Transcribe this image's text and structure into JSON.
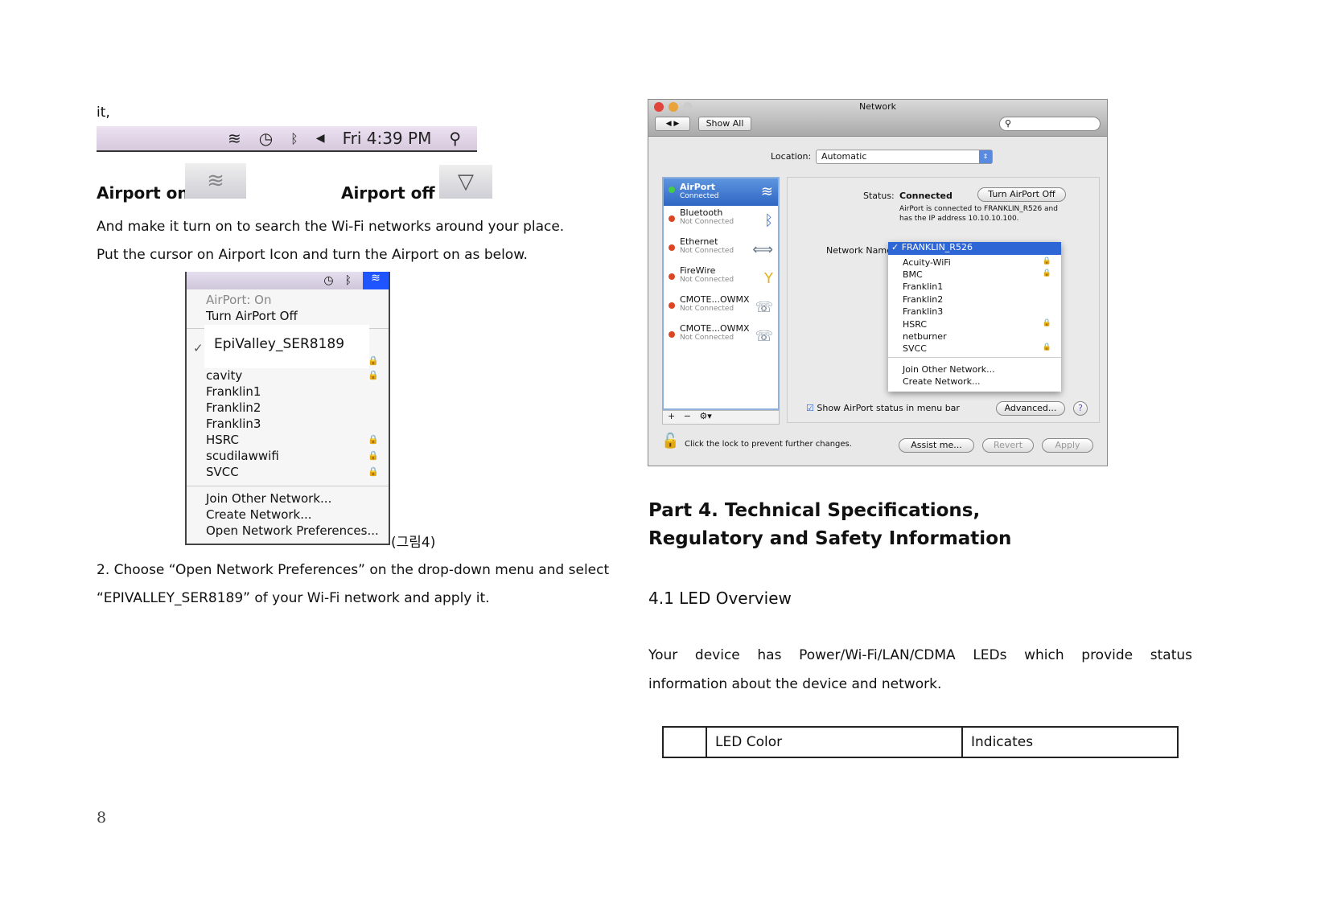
{
  "intro": "it,",
  "menubar": {
    "time": "Fri 4:39 PM",
    "icons": [
      "wifi-icon",
      "time-machine-icon",
      "bluetooth-icon",
      "volume-icon",
      "spotlight-icon"
    ]
  },
  "airport_on_label": "Airport on",
  "airport_off_label": "Airport off",
  "para1": "And make it turn on to search the Wi-Fi networks around your place.",
  "para2": "Put the cursor on Airport Icon and turn the Airport on as below.",
  "menu": {
    "status": "AirPort: On",
    "turn_off": "Turn AirPort Off",
    "selected": "EpiValley_SER8189",
    "networks": [
      {
        "name": "cavity",
        "locked": true
      },
      {
        "name": "Franklin1",
        "locked": false
      },
      {
        "name": "Franklin2",
        "locked": false
      },
      {
        "name": "Franklin3",
        "locked": false
      },
      {
        "name": "HSRC",
        "locked": true
      },
      {
        "name": "scudilawwifi",
        "locked": true
      },
      {
        "name": "SVCC",
        "locked": true
      }
    ],
    "join": "Join Other Network...",
    "create": "Create Network...",
    "open_prefs": "Open Network Preferences..."
  },
  "figure_caption": "(그림4)",
  "step2_line1": "2. Choose “Open Network Preferences” on the drop-down menu and select",
  "step2_line2": "“EPIVALLEY_SER8189” of your Wi-Fi network and apply it.",
  "window": {
    "title": "Network",
    "show_all": "Show All",
    "location_label": "Location:",
    "location_value": "Automatic",
    "services": [
      {
        "name": "AirPort",
        "status": "Connected",
        "icon": "wifi-icon",
        "connected": true
      },
      {
        "name": "Bluetooth",
        "status": "Not Connected",
        "icon": "bluetooth-icon",
        "connected": false
      },
      {
        "name": "Ethernet",
        "status": "Not Connected",
        "icon": "ethernet-icon",
        "connected": false
      },
      {
        "name": "FireWire",
        "status": "Not Connected",
        "icon": "firewire-icon",
        "connected": false
      },
      {
        "name": "CMOTE...OWMX",
        "status": "Not Connected",
        "icon": "phone-icon",
        "connected": false
      },
      {
        "name": "CMOTE...OWMX",
        "status": "Not Connected",
        "icon": "phone-icon",
        "connected": false
      }
    ],
    "status_label": "Status:",
    "status_value": "Connected",
    "turn_off": "Turn AirPort Off",
    "status_desc1": "AirPort is connected to FRANKLIN_R526 and",
    "status_desc2": "has the IP address 10.10.10.100.",
    "network_name_label": "Network Name",
    "selected_network": "FRANKLIN_R526",
    "networks": [
      {
        "name": "Acuity-WiFi",
        "locked": true
      },
      {
        "name": "BMC",
        "locked": true
      },
      {
        "name": "Franklin1",
        "locked": false
      },
      {
        "name": "Franklin2",
        "locked": false
      },
      {
        "name": "Franklin3",
        "locked": false
      },
      {
        "name": "HSRC",
        "locked": true
      },
      {
        "name": "netburner",
        "locked": false
      },
      {
        "name": "SVCC",
        "locked": true
      }
    ],
    "join": "Join Other Network...",
    "create": "Create Network...",
    "show_status": "Show AirPort status in menu bar",
    "show_status_checked": true,
    "advanced": "Advanced...",
    "lock_text": "Click the lock to prevent further changes.",
    "assist": "Assist me...",
    "revert": "Revert",
    "apply": "Apply"
  },
  "part4_line1": "Part 4. Technical Specifications,",
  "part4_line2": "Regulatory and Safety Information",
  "section41": "4.1 LED Overview",
  "led_para1": "Your device has Power/Wi-Fi/LAN/CDMA LEDs which provide status",
  "led_para2": "information about the device and network.",
  "table": {
    "headers": [
      "",
      "LED Color",
      "Indicates"
    ]
  },
  "page_number": "8"
}
